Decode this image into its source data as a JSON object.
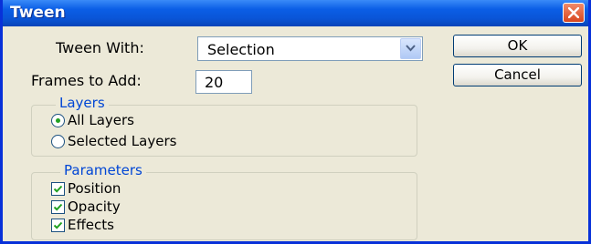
{
  "window": {
    "title": "Tween"
  },
  "form": {
    "tween_with_label": "Tween With:",
    "tween_with_value": "Selection",
    "frames_label": "Frames to Add:",
    "frames_value": "20"
  },
  "buttons": {
    "ok": "OK",
    "cancel": "Cancel"
  },
  "layers": {
    "legend": "Layers",
    "options": [
      {
        "label": "All Layers",
        "selected": true
      },
      {
        "label": "Selected Layers",
        "selected": false
      }
    ]
  },
  "parameters": {
    "legend": "Parameters",
    "items": [
      {
        "label": "Position",
        "checked": true
      },
      {
        "label": "Opacity",
        "checked": true
      },
      {
        "label": "Effects",
        "checked": true
      }
    ]
  },
  "colors": {
    "titlebar": "#0a55d7",
    "dialog_bg": "#ece9d8",
    "group_legend": "#0046d5",
    "check_mark": "#21a121"
  },
  "icons": {
    "close": "close-x-icon",
    "dropdown": "chevron-down-icon"
  }
}
